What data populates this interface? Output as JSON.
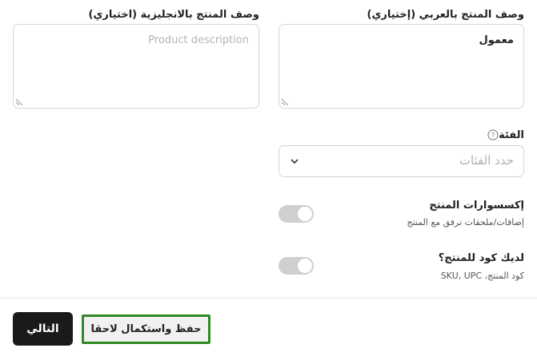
{
  "desc_ar": {
    "label": "وصف المنتج بالعربي (إختياري)",
    "value": "معمول"
  },
  "desc_en": {
    "label": "وصف المنتج بالانجليزية (اختياري)",
    "placeholder": "Product description"
  },
  "category": {
    "label": "الفئة",
    "help_icon": "question-circle-icon",
    "placeholder": "حدد الفئات",
    "chevron_icon": "chevron-down-icon"
  },
  "accessories": {
    "title": "إكسسوارات المنتج",
    "subtitle": "إضافات/ملحقات ترفق مع المنتج",
    "enabled": false
  },
  "product_code": {
    "title": "لديك كود للمنتج؟",
    "subtitle": "كود المنتج، SKU, UPC",
    "enabled": false
  },
  "footer": {
    "next_label": "التالي",
    "save_later_label": "حفظ واستكمال لاحقا",
    "highlight_color": "#2e8b23"
  }
}
